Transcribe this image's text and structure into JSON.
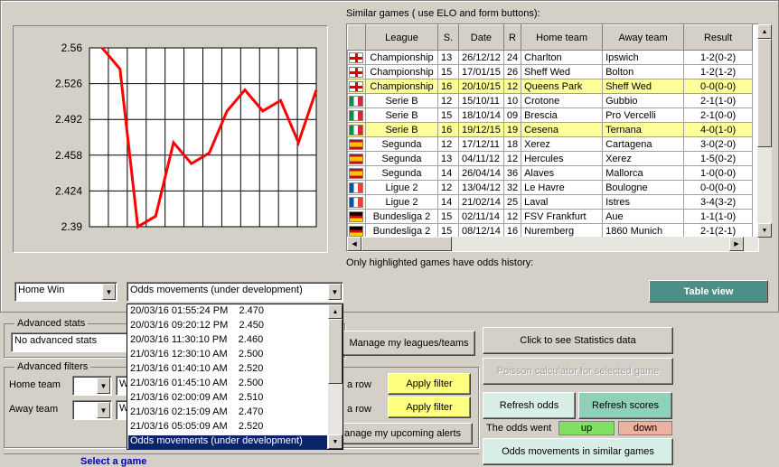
{
  "chart": {
    "ticks": [
      "2.56",
      "2.526",
      "2.492",
      "2.458",
      "2.424",
      "2.39"
    ]
  },
  "chart_data": {
    "type": "line",
    "y": [
      2.56,
      2.54,
      2.39,
      2.4,
      2.47,
      2.45,
      2.46,
      2.5,
      2.52,
      2.5,
      2.51,
      2.47,
      2.52
    ],
    "ylim": [
      2.39,
      2.56
    ],
    "grid": true,
    "color": "#ff0000"
  },
  "similar": {
    "title": "Similar games ( use ELO and form buttons):",
    "footer": "Only highlighted games have odds history:",
    "columns": [
      "League",
      "S.",
      "Date",
      "R",
      "Home team",
      "Away team",
      "Result"
    ],
    "rows": [
      {
        "flag": "en",
        "league": "Championship",
        "s": "13",
        "date": "26/12/12",
        "r": "24",
        "home": "Charlton",
        "away": "Ipswich",
        "result": "1-2(0-2)",
        "hl": false
      },
      {
        "flag": "en",
        "league": "Championship",
        "s": "15",
        "date": "17/01/15",
        "r": "26",
        "home": "Sheff Wed",
        "away": "Bolton",
        "result": "1-2(1-2)",
        "hl": false
      },
      {
        "flag": "en",
        "league": "Championship",
        "s": "16",
        "date": "20/10/15",
        "r": "12",
        "home": "Queens Park",
        "away": "Sheff Wed",
        "result": "0-0(0-0)",
        "hl": true
      },
      {
        "flag": "it",
        "league": "Serie B",
        "s": "12",
        "date": "15/10/11",
        "r": "10",
        "home": "Crotone",
        "away": "Gubbio",
        "result": "2-1(1-0)",
        "hl": false
      },
      {
        "flag": "it",
        "league": "Serie B",
        "s": "15",
        "date": "18/10/14",
        "r": "09",
        "home": "Brescia",
        "away": "Pro Vercelli",
        "result": "2-1(0-0)",
        "hl": false
      },
      {
        "flag": "it",
        "league": "Serie B",
        "s": "16",
        "date": "19/12/15",
        "r": "19",
        "home": "Cesena",
        "away": "Ternana",
        "result": "4-0(1-0)",
        "hl": true
      },
      {
        "flag": "es",
        "league": "Segunda",
        "s": "12",
        "date": "17/12/11",
        "r": "18",
        "home": "Xerez",
        "away": "Cartagena",
        "result": "3-0(2-0)",
        "hl": false
      },
      {
        "flag": "es",
        "league": "Segunda",
        "s": "13",
        "date": "04/11/12",
        "r": "12",
        "home": "Hercules",
        "away": "Xerez",
        "result": "1-5(0-2)",
        "hl": false
      },
      {
        "flag": "es",
        "league": "Segunda",
        "s": "14",
        "date": "26/04/14",
        "r": "36",
        "home": "Alaves",
        "away": "Mallorca",
        "result": "1-0(0-0)",
        "hl": false
      },
      {
        "flag": "fr",
        "league": "Ligue 2",
        "s": "12",
        "date": "13/04/12",
        "r": "32",
        "home": "Le Havre",
        "away": "Boulogne",
        "result": "0-0(0-0)",
        "hl": false
      },
      {
        "flag": "fr",
        "league": "Ligue 2",
        "s": "14",
        "date": "21/02/14",
        "r": "25",
        "home": "Laval",
        "away": "Istres",
        "result": "3-4(3-2)",
        "hl": false
      },
      {
        "flag": "de",
        "league": "Bundesliga 2",
        "s": "15",
        "date": "02/11/14",
        "r": "12",
        "home": "FSV Frankfurt",
        "away": "Aue",
        "result": "1-1(1-0)",
        "hl": false
      },
      {
        "flag": "de",
        "league": "Bundesliga 2",
        "s": "15",
        "date": "08/12/14",
        "r": "16",
        "home": "Nuremberg",
        "away": "1860 Munich",
        "result": "2-1(2-1)",
        "hl": false
      }
    ]
  },
  "market_select": "Home Win",
  "odds_select": "Odds movements (under development)",
  "odds_list": [
    "20/03/16 01:55:24 PM    2.470",
    "20/03/16 09:20:12 PM    2.450",
    "20/03/16 11:30:10 PM    2.460",
    "21/03/16 12:30:10 AM    2.500",
    "21/03/16 01:40:10 AM    2.520",
    "21/03/16 01:45:10 AM    2.500",
    "21/03/16 02:00:09 AM    2.510",
    "21/03/16 02:15:09 AM    2.470",
    "21/03/16 05:05:09 AM    2.520",
    "Odds movements (under development)"
  ],
  "table_view": "Table view",
  "adv_stats": {
    "title": "Advanced stats",
    "value": "No advanced stats"
  },
  "adv_filters": {
    "title": "Advanced filters",
    "home": "Home team",
    "away": "Away team",
    "w1": "W",
    "w2": "W",
    "row1": "a row",
    "row2": "a row",
    "apply1": "Apply filter",
    "apply2": "Apply filter",
    "alerts": "anage my upcoming alerts"
  },
  "manage_leagues": "Manage my leagues/teams",
  "stats_btn": "Click to see Statistics data",
  "poisson_btn": "Poisson calculator for selected game",
  "refresh_odds": "Refresh odds",
  "refresh_scores": "Refresh scores",
  "odds_went": "The odds went",
  "up": "up",
  "down": "down",
  "odds_similar": "Odds movements in similar games",
  "select_game": "Select a game",
  "colors": {
    "teal": "#4d8f86",
    "up": "#80e060",
    "down": "#f0b0a0",
    "highlight": "#ffff99",
    "line": "#ff0000"
  }
}
